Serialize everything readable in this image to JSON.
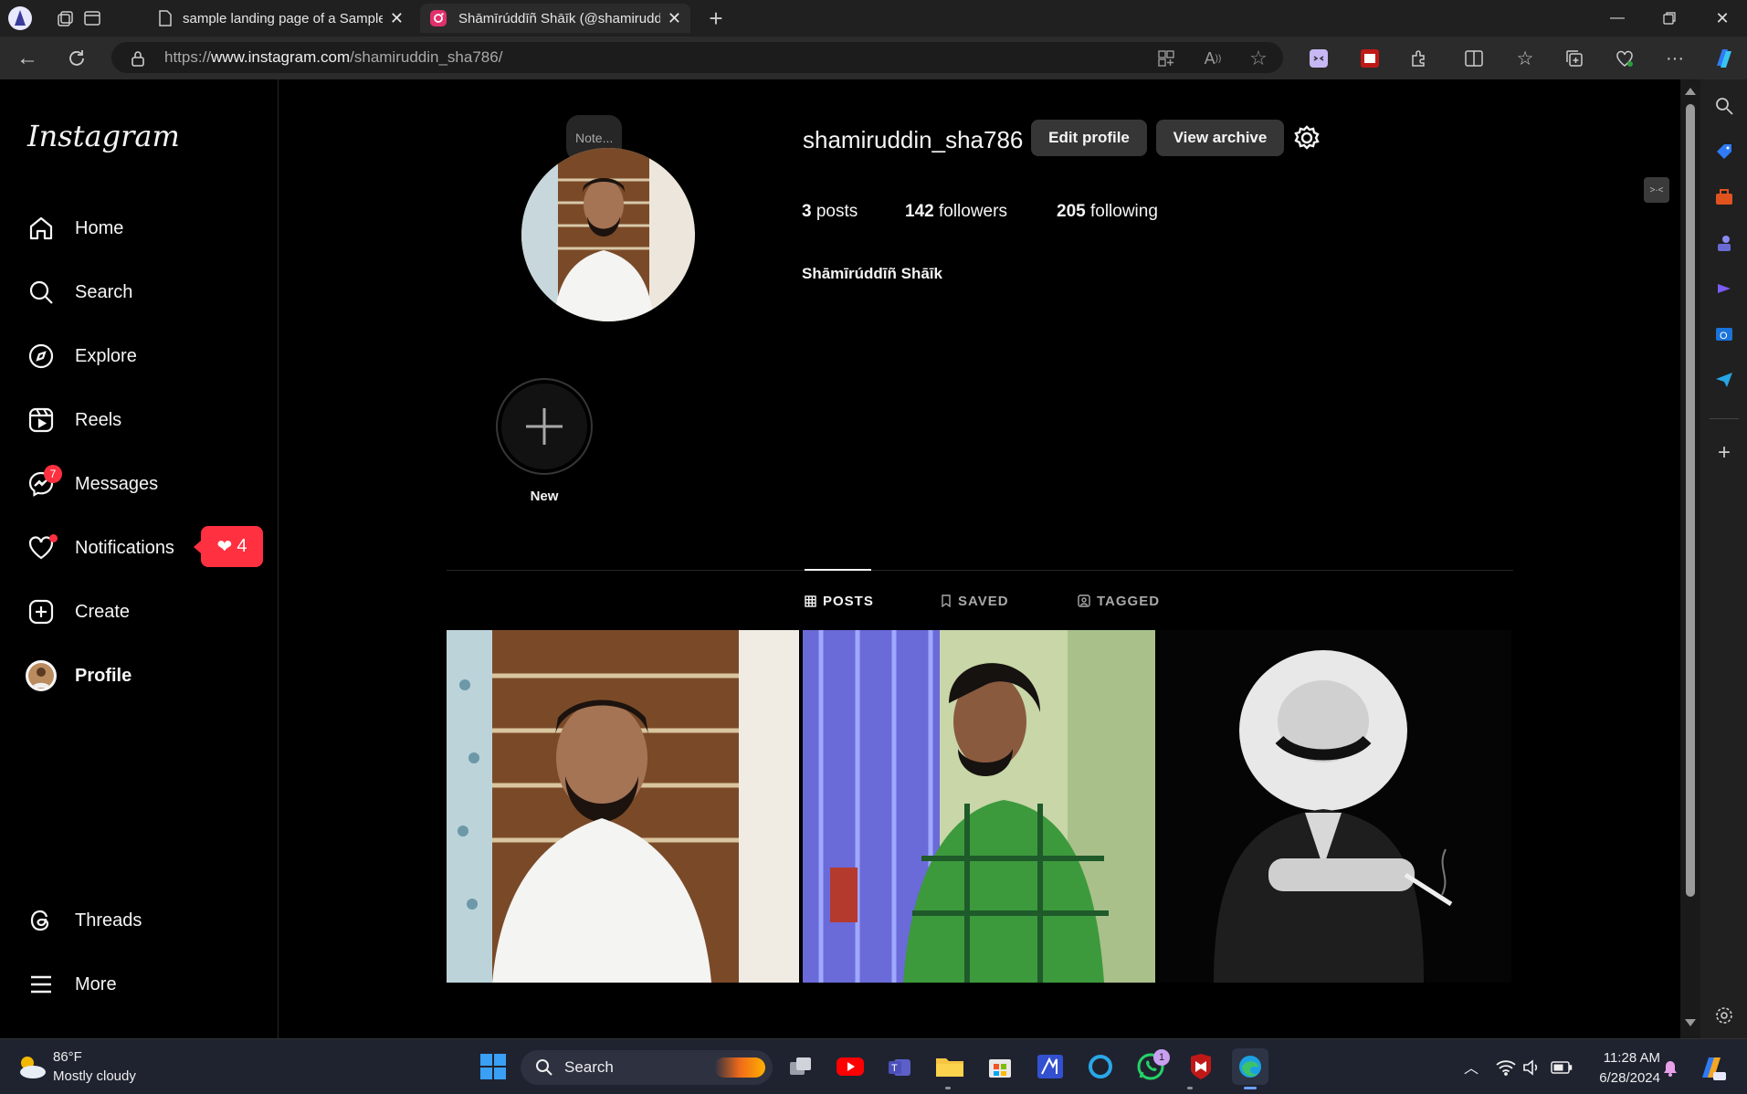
{
  "browser": {
    "tabs": [
      {
        "title": "sample landing page of a Sample",
        "active": false
      },
      {
        "title": "Shāmīrúddīñ Shāīk (@shamiruddin_sha786)",
        "active": true
      }
    ],
    "url_prefix": "https://",
    "url_host": "www.instagram.com",
    "url_path": "/shamiruddin_sha786/"
  },
  "sidebar": {
    "logo": "Instagram",
    "items": [
      {
        "label": "Home",
        "icon": "home-icon"
      },
      {
        "label": "Search",
        "icon": "search-icon"
      },
      {
        "label": "Explore",
        "icon": "compass-icon"
      },
      {
        "label": "Reels",
        "icon": "reels-icon"
      },
      {
        "label": "Messages",
        "icon": "messenger-icon",
        "badge": "7"
      },
      {
        "label": "Notifications",
        "icon": "heart-icon",
        "popup": "4"
      },
      {
        "label": "Create",
        "icon": "plus-square-icon"
      },
      {
        "label": "Profile",
        "icon": "avatar-icon"
      }
    ],
    "bottom": [
      {
        "label": "Threads",
        "icon": "threads-icon"
      },
      {
        "label": "More",
        "icon": "menu-icon"
      }
    ]
  },
  "profile": {
    "note": "Note...",
    "username": "shamiruddin_sha786",
    "edit_label": "Edit profile",
    "archive_label": "View archive",
    "posts_count": "3",
    "posts_label": "posts",
    "followers_count": "142",
    "followers_label": "followers",
    "following_count": "205",
    "following_label": "following",
    "full_name": "Shāmīrúddīñ Shāīk",
    "highlight_new": "New"
  },
  "tabs": {
    "posts": "POSTS",
    "saved": "SAVED",
    "tagged": "TAGGED"
  },
  "taskbar": {
    "weather_temp": "86°F",
    "weather_desc": "Mostly cloudy",
    "search_label": "Search",
    "time": "11:28 AM",
    "date": "6/28/2024",
    "whatsapp_badge": "1"
  },
  "colors": {
    "background": "#000000",
    "button": "#363636",
    "notification_red": "#ff3040",
    "taskbar": "#1f2330"
  }
}
